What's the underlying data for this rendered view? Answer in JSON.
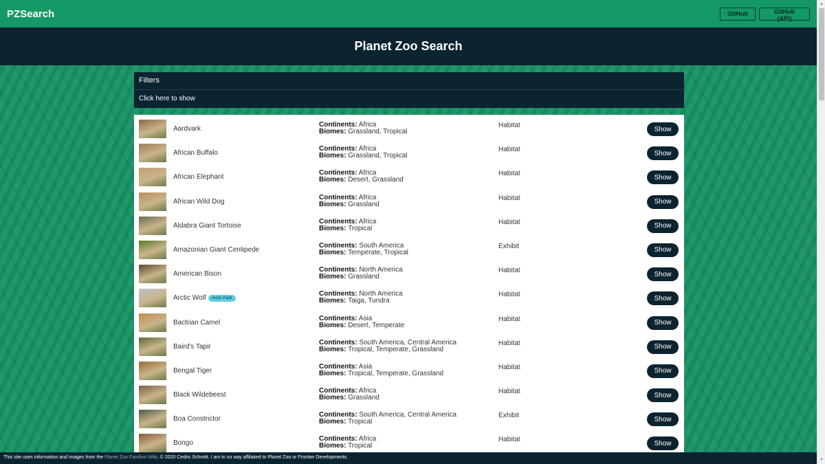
{
  "header": {
    "brand": "PZSearch",
    "github_label": "GitHub",
    "github_api_label": "GitHub (API)"
  },
  "hero": {
    "title": "Planet Zoo Search"
  },
  "filters": {
    "title": "Filters",
    "toggle_label": "Click here to show"
  },
  "labels": {
    "continents": "Continents:",
    "biomes": "Biomes:",
    "show": "Show"
  },
  "animals": [
    {
      "name": "Aardvark",
      "badge": "",
      "continents": "Africa",
      "biomes": "Grassland, Tropical",
      "type": "Habitat",
      "thumb_color": "#8a6a4a"
    },
    {
      "name": "African Buffalo",
      "badge": "",
      "continents": "Africa",
      "biomes": "Grassland, Tropical",
      "type": "Habitat",
      "thumb_color": "#a08060"
    },
    {
      "name": "African Elephant",
      "badge": "",
      "continents": "Africa",
      "biomes": "Desert, Grassland",
      "type": "Habitat",
      "thumb_color": "#c2a27a"
    },
    {
      "name": "African Wild Dog",
      "badge": "",
      "continents": "Africa",
      "biomes": "Grassland",
      "type": "Habitat",
      "thumb_color": "#b89060"
    },
    {
      "name": "Aldabra Giant Tortoise",
      "badge": "",
      "continents": "Africa",
      "biomes": "Tropical",
      "type": "Habitat",
      "thumb_color": "#6a6a55"
    },
    {
      "name": "Amazonian Giant Centipede",
      "badge": "",
      "continents": "South America",
      "biomes": "Temperate, Tropical",
      "type": "Exhibit",
      "thumb_color": "#5a7a2a"
    },
    {
      "name": "American Bison",
      "badge": "",
      "continents": "North America",
      "biomes": "Grassland",
      "type": "Habitat",
      "thumb_color": "#5a4a35"
    },
    {
      "name": "Arctic Wolf",
      "badge": "Arctic Pack",
      "continents": "North America",
      "biomes": "Taiga, Tundra",
      "type": "Habitat",
      "thumb_color": "#b8c4cc"
    },
    {
      "name": "Bactrian Camel",
      "badge": "",
      "continents": "Asia",
      "biomes": "Desert, Temperate",
      "type": "Habitat",
      "thumb_color": "#c28a50"
    },
    {
      "name": "Baird's Tapir",
      "badge": "",
      "continents": "South America, Central America",
      "biomes": "Tropical, Temperate, Grassland",
      "type": "Habitat",
      "thumb_color": "#5a6a3a"
    },
    {
      "name": "Bengal Tiger",
      "badge": "",
      "continents": "Asia",
      "biomes": "Tropical, Temperate, Grassland",
      "type": "Habitat",
      "thumb_color": "#9a6a3a"
    },
    {
      "name": "Black Wildebeest",
      "badge": "",
      "continents": "Africa",
      "biomes": "Grassland",
      "type": "Habitat",
      "thumb_color": "#7a6048"
    },
    {
      "name": "Boa Constrictor",
      "badge": "",
      "continents": "South America, Central America",
      "biomes": "Tropical",
      "type": "Exhibit",
      "thumb_color": "#4a5a4a"
    },
    {
      "name": "Bongo",
      "badge": "",
      "continents": "Africa",
      "biomes": "Tropical",
      "type": "Habitat",
      "thumb_color": "#8a5a3a"
    }
  ],
  "footer": {
    "text_before": "This site uses information and images from the ",
    "link_text": "Planet Zoo Fandom Wiki",
    "text_after": ".  © 2020 Cedric Schmitt.  I am in no way affiliated to Planet Zoo or Frontier Developments."
  }
}
